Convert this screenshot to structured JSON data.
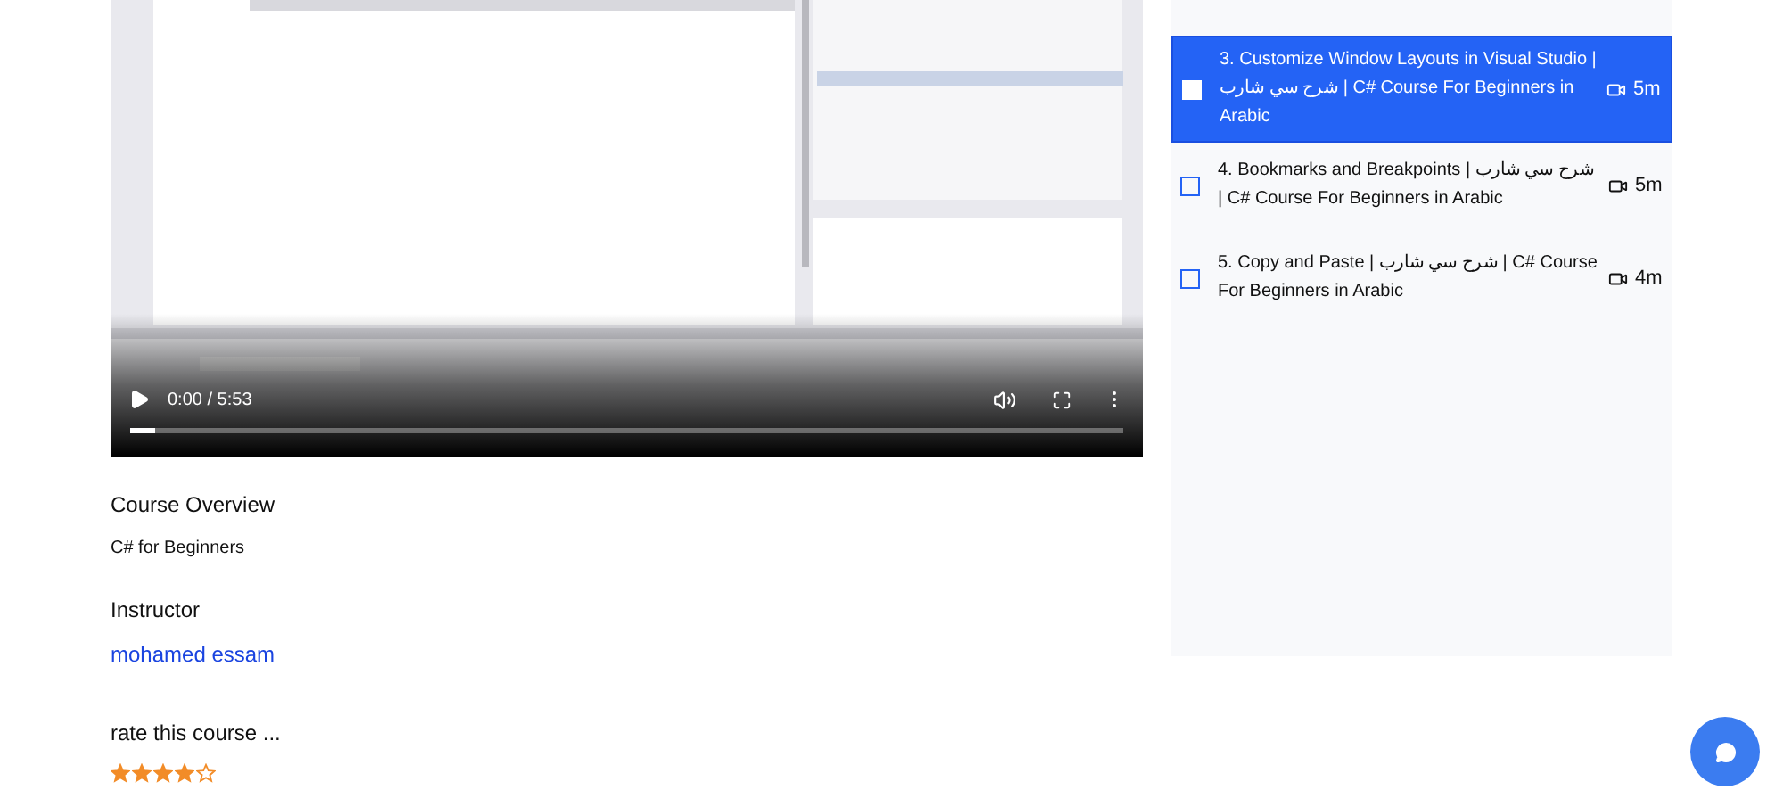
{
  "video": {
    "time": "0:00 / 5:53",
    "progress": {
      "level": 0.025
    }
  },
  "overview": {
    "heading": "Course Overview",
    "text": "C# for Beginners"
  },
  "instructor": {
    "heading": "Instructor",
    "name": "mohamed essam"
  },
  "rating": {
    "label": "rate this course ...",
    "stars": 4
  },
  "lessons": [
    {
      "title": "3. Customize Window Layouts in Visual Studio | شرح سي شارب | C# Course For Beginners in Arabic",
      "duration": "5m",
      "selected": true
    },
    {
      "title": "4. Bookmarks and Breakpoints | شرح سي شارب | C# Course For Beginners in Arabic",
      "duration": "5m",
      "selected": false
    },
    {
      "title": "5. Copy and Paste | شرح سي شارب | C# Course For Beginners in Arabic",
      "duration": "4m",
      "selected": false
    }
  ]
}
